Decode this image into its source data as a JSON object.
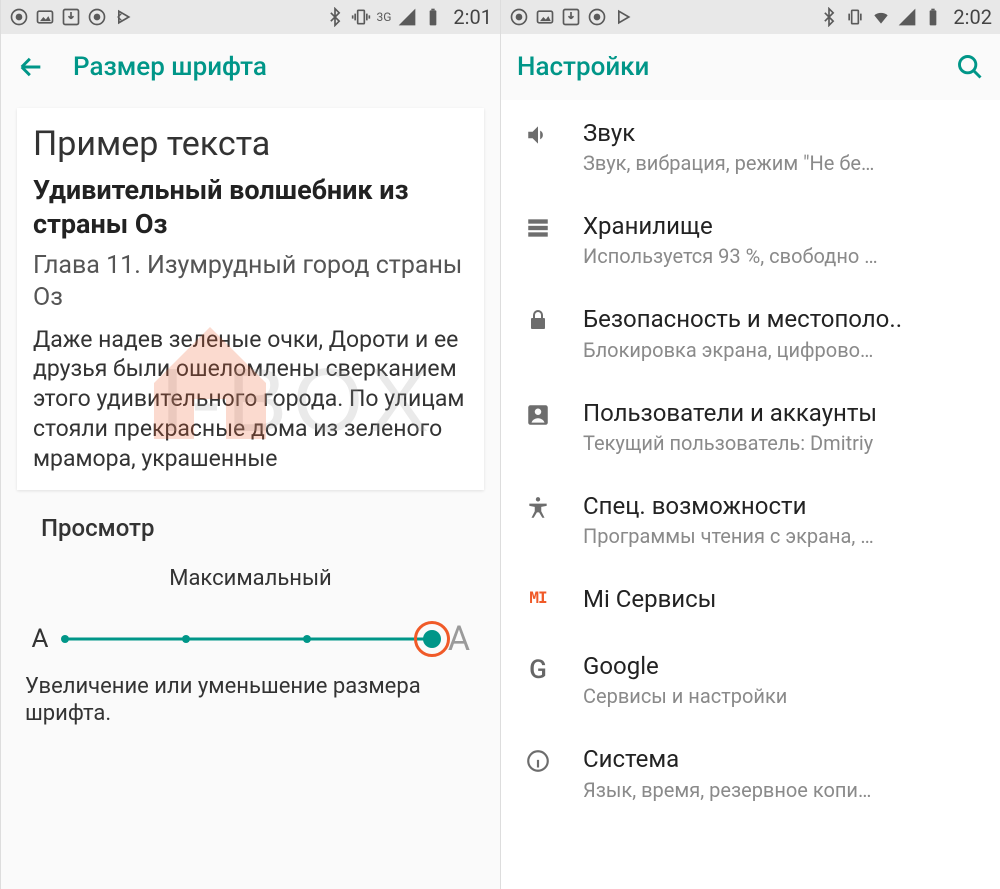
{
  "left": {
    "status": {
      "time": "2:01",
      "network": "3G"
    },
    "toolbar": {
      "title": "Размер шрифта"
    },
    "sample": {
      "heading": "Пример текста",
      "title": "Удивительный волшебник из страны Оз",
      "chapter": "Глава 11. Изумрудный город страны Оз",
      "body": "Даже надев зеленые очки, Дороти и ее друзья были ошеломлены сверканием этого удивительного города. По улицам стояли прекрасные дома из зеленого мрамора, украшенные"
    },
    "preview_label": "Просмотр",
    "slider": {
      "caption": "Максимальный",
      "small": "A",
      "large": "A",
      "help": "Увеличение или уменьшение размера шрифта."
    }
  },
  "right": {
    "status": {
      "time": "2:02"
    },
    "toolbar": {
      "title": "Настройки"
    },
    "items": [
      {
        "title": "Звук",
        "sub": "Звук, вибрация, режим \"Не бе…",
        "icon": "sound"
      },
      {
        "title": "Хранилище",
        "sub": "Используется 93 %, свободно …",
        "icon": "storage"
      },
      {
        "title": "Безопасность и местополо..",
        "sub": "Блокировка экрана, цифрово…",
        "icon": "lock"
      },
      {
        "title": "Пользователи и аккаунты",
        "sub": "Текущий пользователь: Dmitriy",
        "icon": "account"
      },
      {
        "title": "Спец. возможности",
        "sub": "Программы чтения с экрана, …",
        "icon": "accessibility"
      },
      {
        "title": "Mi Сервисы",
        "sub": "",
        "icon": "mi"
      },
      {
        "title": "Google",
        "sub": "Сервисы и настройки",
        "icon": "google"
      },
      {
        "title": "Система",
        "sub": "Язык, время, резервное копи…",
        "icon": "info"
      }
    ]
  }
}
